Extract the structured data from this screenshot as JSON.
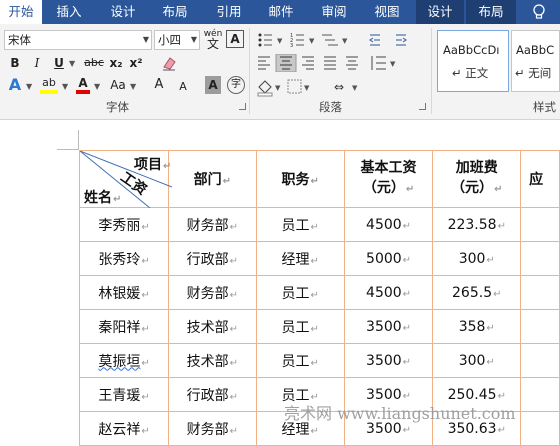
{
  "tabs": [
    "开始",
    "插入",
    "设计",
    "布局",
    "引用",
    "邮件",
    "审阅",
    "视图",
    "设计",
    "布局"
  ],
  "font": {
    "name": "宋体",
    "size": "小四",
    "wen": "wén",
    "char_border": "A"
  },
  "font_buttons": {
    "bold": "B",
    "italic": "I",
    "underline": "U",
    "strike": "abc",
    "sub": "x₂",
    "sup": "x²",
    "effects": "A",
    "highlight": "ab",
    "color": "A",
    "case": "Aa",
    "grow": "A",
    "shrink": "A",
    "shade": "A",
    "enclose": "字"
  },
  "colors": {
    "tabbar": "#2b579a",
    "ribbon": "#f3f3f3",
    "border": "#f4b183",
    "highlight": "#ffff00",
    "font_color": "#e00000"
  },
  "groups": {
    "font": "字体",
    "paragraph": "段落",
    "styles": "样式"
  },
  "styles": [
    {
      "sample": "AaBbCcDı",
      "name": "↵ 正文"
    },
    {
      "sample": "AaBbC",
      "name": "↵ 无间"
    }
  ],
  "table": {
    "diag": {
      "top": "项目",
      "mid": "工资",
      "bottom": "姓名"
    },
    "headers": [
      [
        "部门"
      ],
      [
        "职务"
      ],
      [
        "基本工资",
        "（元）"
      ],
      [
        "加班费",
        "（元）"
      ],
      [
        "应"
      ]
    ],
    "rows": [
      [
        "李秀丽",
        "财务部",
        "员工",
        "4500",
        "223.58"
      ],
      [
        "张秀玲",
        "行政部",
        "经理",
        "5000",
        "300"
      ],
      [
        "林银媛",
        "财务部",
        "员工",
        "4500",
        "265.5"
      ],
      [
        "秦阳祥",
        "技术部",
        "员工",
        "3500",
        "358"
      ],
      [
        "莫振垣",
        "技术部",
        "员工",
        "3500",
        "300"
      ],
      [
        "王青瑗",
        "行政部",
        "员工",
        "3500",
        "250.45"
      ],
      [
        "赵云祥",
        "财务部",
        "经理",
        "3500",
        "350.63"
      ]
    ]
  },
  "watermark": "亮术网 www.liangshunet.com"
}
